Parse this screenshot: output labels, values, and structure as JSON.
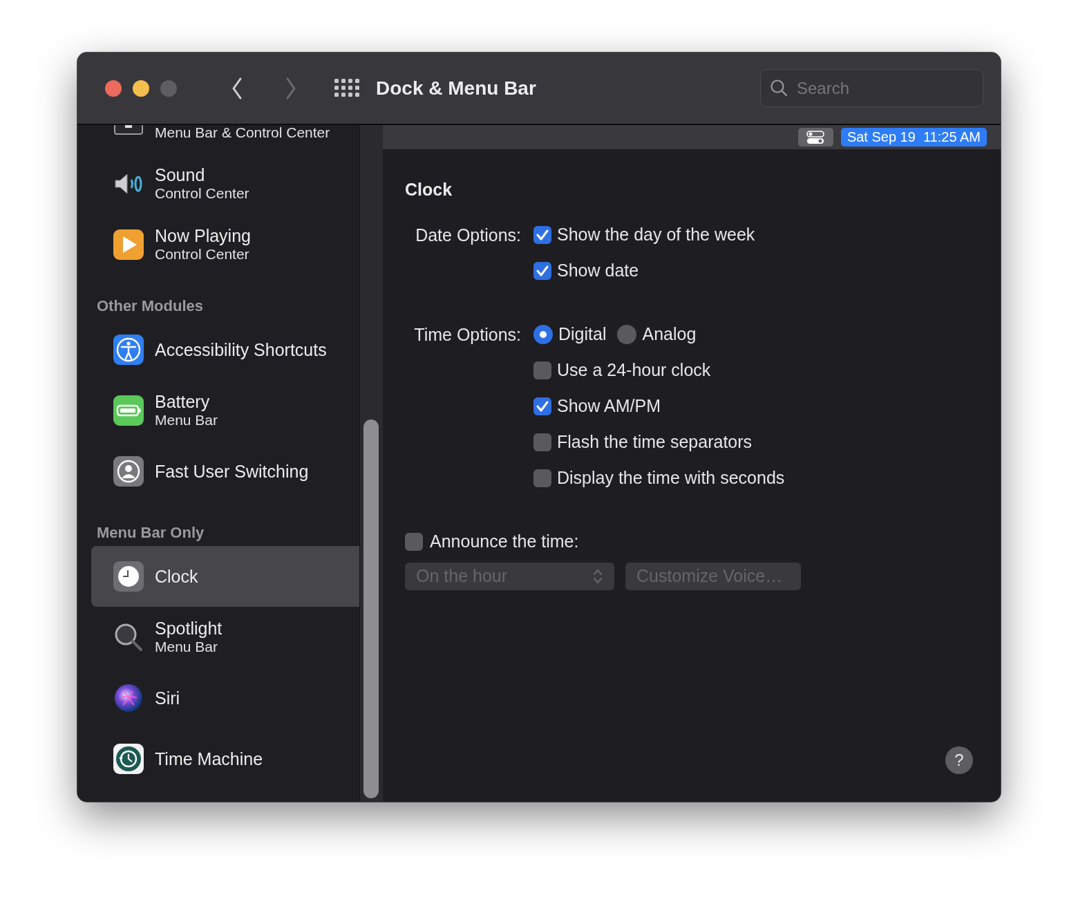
{
  "window": {
    "title": "Dock & Menu Bar",
    "back_enabled": true,
    "forward_enabled": false
  },
  "search": {
    "placeholder": "Search"
  },
  "sidebar": {
    "items": [
      {
        "kind": "item",
        "subtitle": "Menu Bar & Control Center",
        "selected": false
      },
      {
        "kind": "item",
        "title": "Sound",
        "subtitle": "Control Center",
        "selected": false
      },
      {
        "kind": "item",
        "title": "Now Playing",
        "subtitle": "Control Center",
        "selected": false
      },
      {
        "kind": "header",
        "title": "Other Modules"
      },
      {
        "kind": "item",
        "title": "Accessibility Shortcuts",
        "selected": false
      },
      {
        "kind": "item",
        "title": "Battery",
        "subtitle": "Menu Bar",
        "selected": false
      },
      {
        "kind": "item",
        "title": "Fast User Switching",
        "selected": false
      },
      {
        "kind": "header",
        "title": "Menu Bar Only"
      },
      {
        "kind": "item",
        "title": "Clock",
        "selected": true
      },
      {
        "kind": "item",
        "title": "Spotlight",
        "subtitle": "Menu Bar",
        "selected": false
      },
      {
        "kind": "item",
        "title": "Siri",
        "selected": false
      },
      {
        "kind": "item",
        "title": "Time Machine",
        "selected": false
      }
    ]
  },
  "menubar_preview": {
    "clock": "Sat Sep 19  11:25 AM"
  },
  "pane": {
    "title": "Clock",
    "date_options": {
      "label": "Date Options:",
      "options": [
        {
          "label": "Show the day of the week",
          "checked": true
        },
        {
          "label": "Show date",
          "checked": true
        }
      ]
    },
    "time_options": {
      "label": "Time Options:",
      "styles": [
        {
          "label": "Digital",
          "selected": true
        },
        {
          "label": "Analog",
          "selected": false
        }
      ],
      "options": [
        {
          "label": "Use a 24-hour clock",
          "checked": false
        },
        {
          "label": "Show AM/PM",
          "checked": true
        },
        {
          "label": "Flash the time separators",
          "checked": false
        },
        {
          "label": "Display the time with seconds",
          "checked": false
        }
      ]
    },
    "announce": {
      "label": "Announce the time:",
      "checked": false
    },
    "interval_select": {
      "value": "On the hour",
      "disabled": true
    },
    "customize_button": {
      "label": "Customize Voice…",
      "disabled": true
    },
    "help_button": {
      "label": "?"
    }
  }
}
